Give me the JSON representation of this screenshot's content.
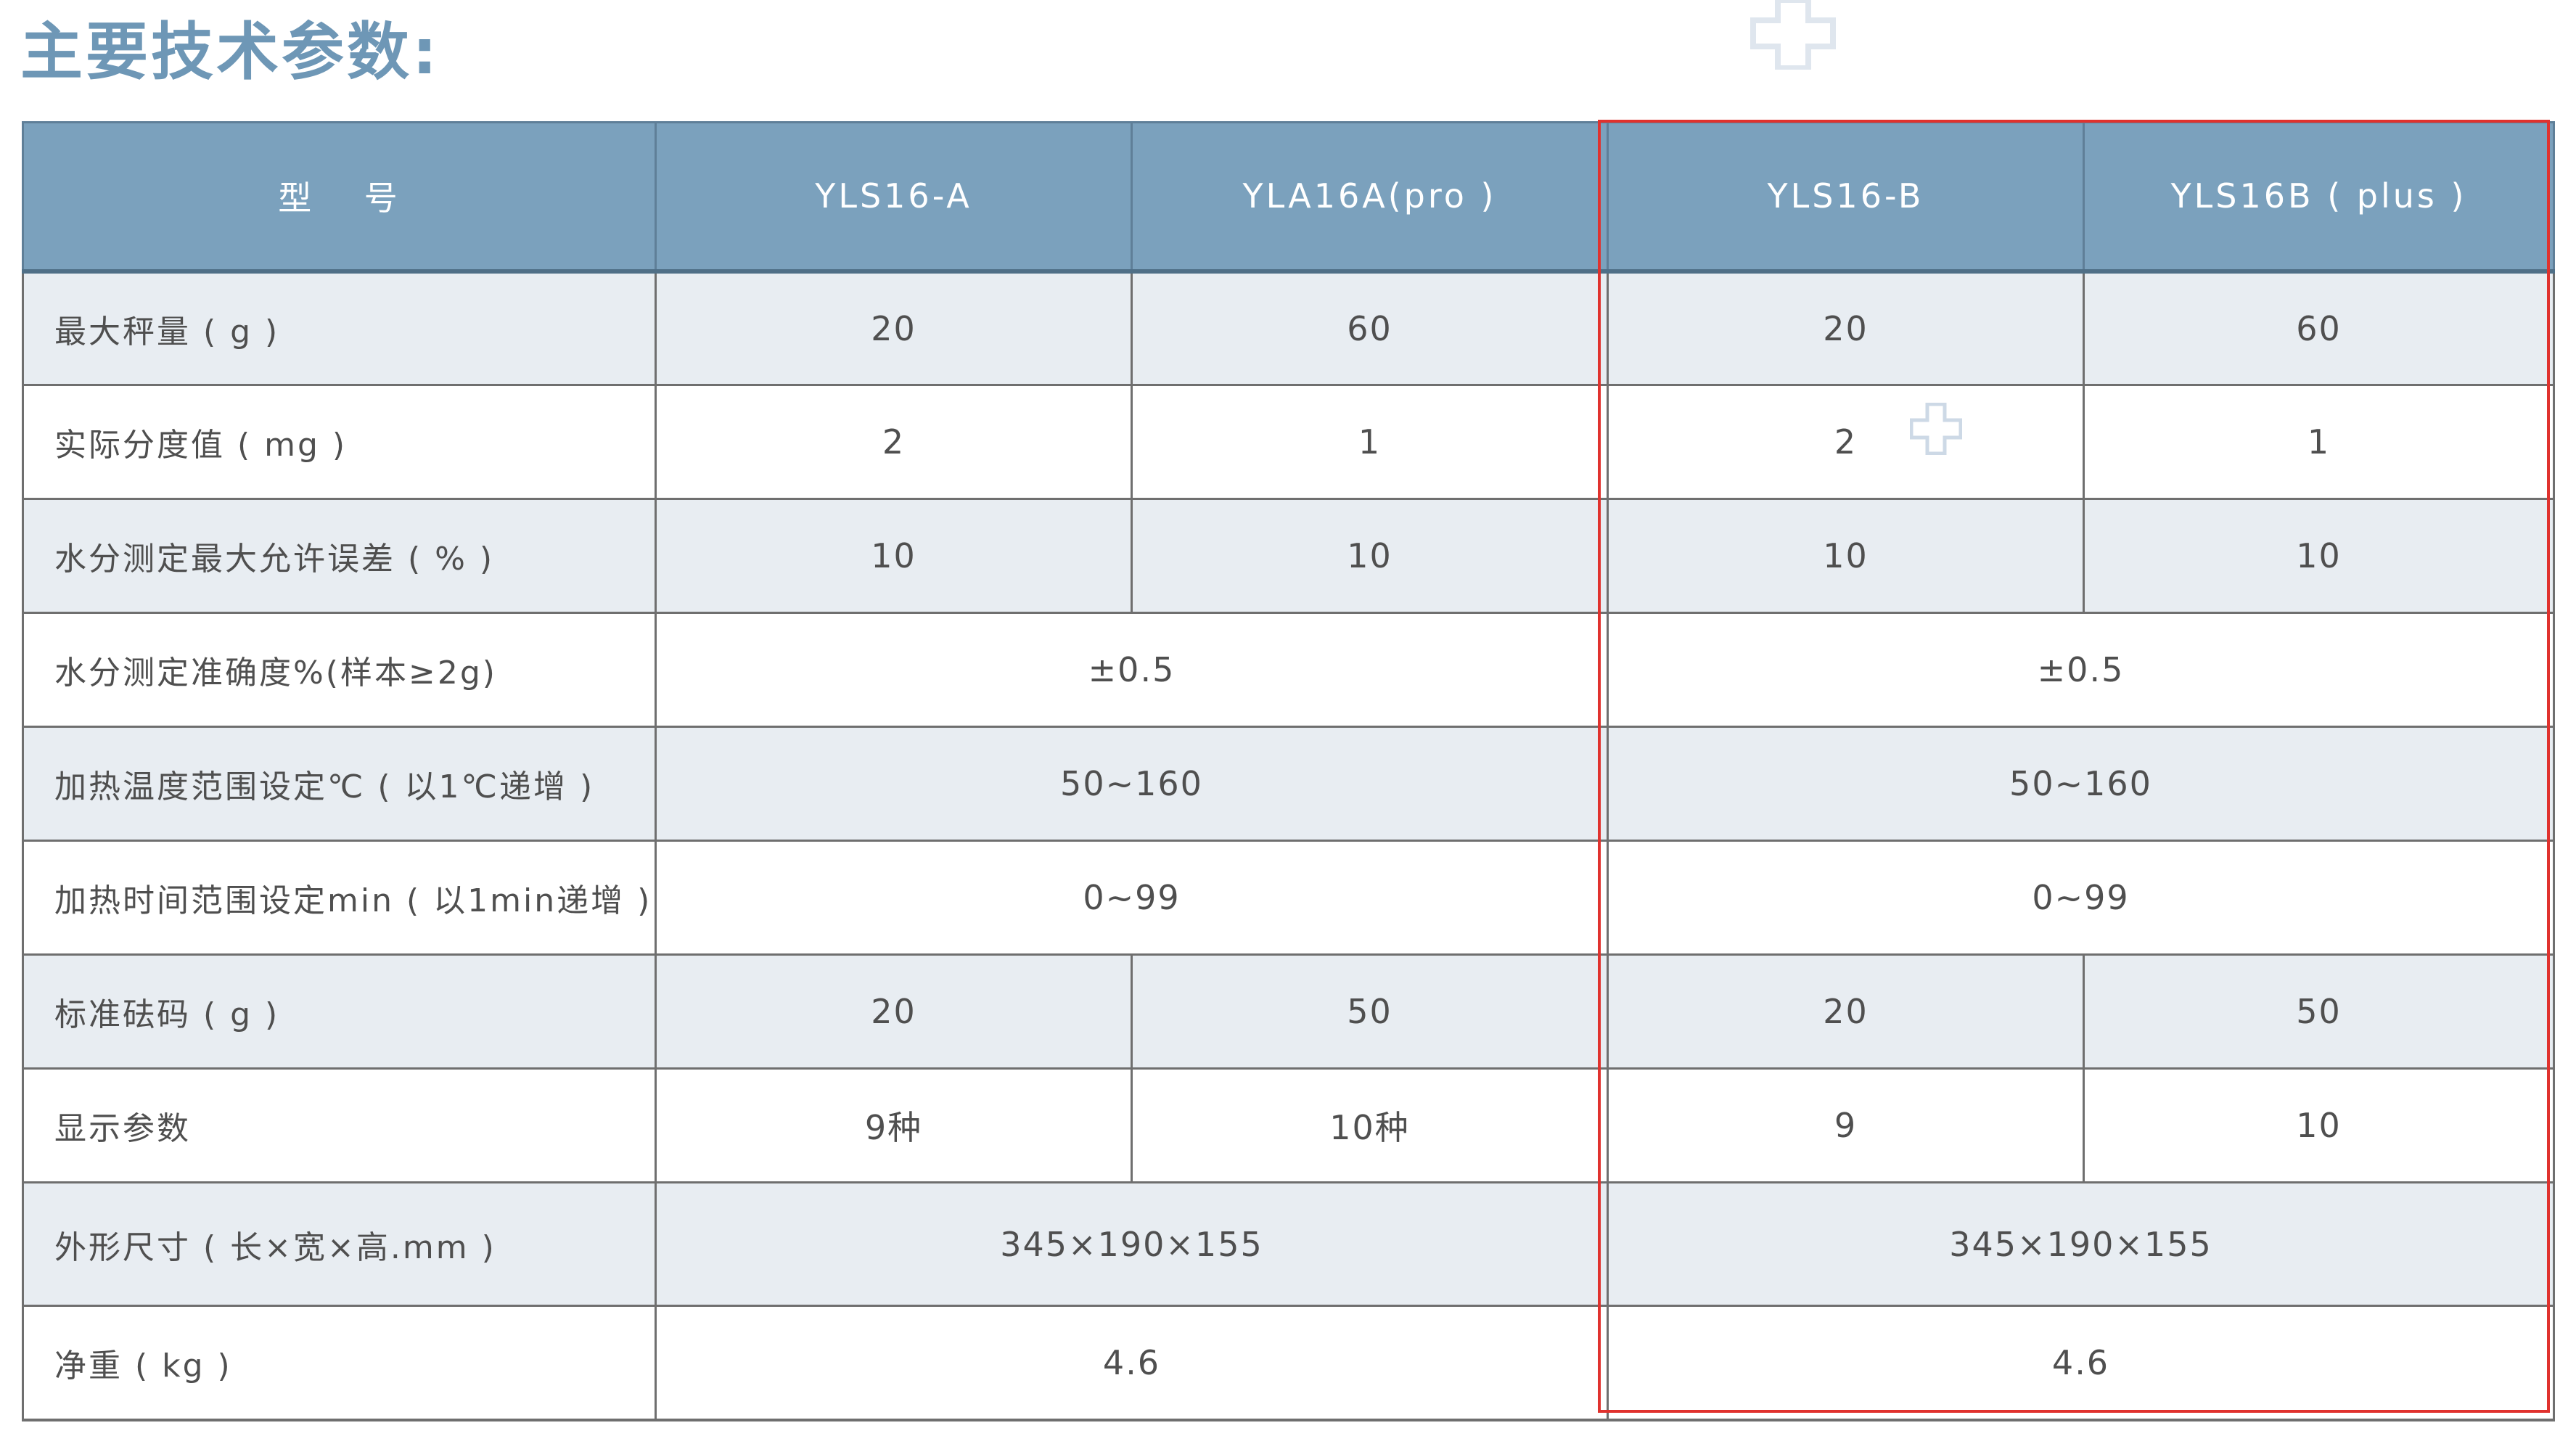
{
  "title": "主要技术参数:",
  "icons": {
    "top_watermark": "cross-outline-icon",
    "cell_watermark": "cross-outline-icon"
  },
  "colors": {
    "title": "#6e97b6",
    "header_bg": "#7ba1bd",
    "shaded_row": "#e8edf2",
    "highlight_border": "#e0322e"
  },
  "table": {
    "headers": [
      "型　 号",
      "YLS16-A",
      "YLA16A(pro )",
      "YLS16-B",
      "YLS16B ( plus )"
    ],
    "rows": [
      {
        "label": "最大秤量 ( g )",
        "values": [
          "20",
          "60",
          "20",
          "60"
        ]
      },
      {
        "label": "实际分度值 ( mg )",
        "values": [
          "2",
          "1",
          "2",
          "1"
        ]
      },
      {
        "label": "水分测定最大允许误差 ( % )",
        "values": [
          "10",
          "10",
          "10",
          "10"
        ]
      },
      {
        "label": "水分测定准确度%(样本≥2g)",
        "values": [
          "±0.5",
          "±0.5"
        ]
      },
      {
        "label": "加热温度范围设定℃ ( 以1℃递增 )",
        "values": [
          "50~160",
          "50~160"
        ]
      },
      {
        "label": "加热时间范围设定min ( 以1min递增 )",
        "values": [
          "0~99",
          "0~99"
        ]
      },
      {
        "label": "标准砝码 ( g )",
        "values": [
          "20",
          "50",
          "20",
          "50"
        ]
      },
      {
        "label": "显示参数",
        "values": [
          "9种",
          "10种",
          "9",
          "10"
        ]
      },
      {
        "label": "外形尺寸 ( 长×宽×高.mm )",
        "values": [
          "345×190×155",
          "345×190×155"
        ]
      },
      {
        "label": "净重 ( kg )",
        "values": [
          "4.6",
          "4.6"
        ]
      }
    ]
  }
}
